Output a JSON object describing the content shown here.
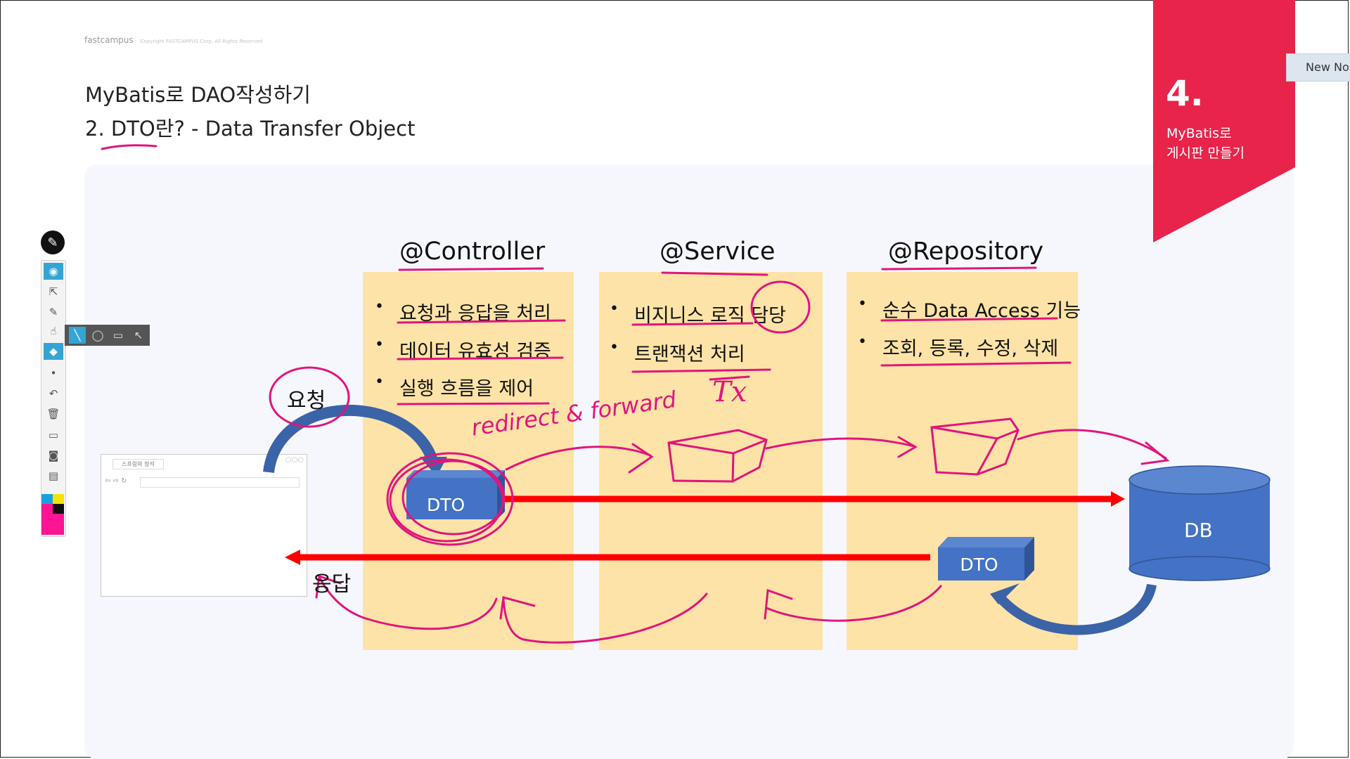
{
  "slide": {
    "logo": "fastcampus",
    "logo_note": "Copyright FASTCAMPUS Corp. All Rights Reserved",
    "title_line1": "MyBatis로 DAO작성하기",
    "title_line2": "2. DTO란? - Data Transfer Object"
  },
  "chapter_banner": {
    "number": "4.",
    "line1": "MyBatis로",
    "line2": "게시판 만들기",
    "color": "#e8244b"
  },
  "new_note_button": "New No",
  "layers": {
    "controller": {
      "heading": "@Controller",
      "bullets": [
        "요청과 응답을 처리",
        "데이터 유효성 검증",
        "실행 흐름을 제어"
      ]
    },
    "service": {
      "heading": "@Service",
      "bullets": [
        "비지니스 로직 담당",
        "트랜잭션 처리"
      ]
    },
    "repository": {
      "heading": "@Repository",
      "bullets": [
        "순수 Data Access 기능",
        "조회, 등록, 수정, 삭제"
      ]
    }
  },
  "diagram": {
    "dto_request_label": "DTO",
    "dto_response_label": "DTO",
    "db_label": "DB",
    "request_label": "요청",
    "response_label": "응답"
  },
  "handwriting": {
    "tx": "Tx",
    "redirect_forward": "redirect & forward"
  },
  "colors": {
    "column_fill": "#fde3a7",
    "box_blue": "#4472c4",
    "arrow_red": "#ff0000",
    "annotation_pink": "#e0157e"
  },
  "toolbar": {
    "tools": [
      "pen-logo-icon",
      "eye-icon",
      "select-arrow-icon",
      "pencil-icon",
      "pointer-icon",
      "eraser-icon",
      "dot-icon",
      "undo-icon",
      "trash-icon",
      "screen-icon",
      "camera-icon",
      "clipboard-icon"
    ],
    "flyout": [
      "line-icon",
      "circle-icon",
      "rectangle-icon",
      "arrow-icon"
    ]
  },
  "browser_mockup": {
    "tab": "스프링의 정석"
  }
}
